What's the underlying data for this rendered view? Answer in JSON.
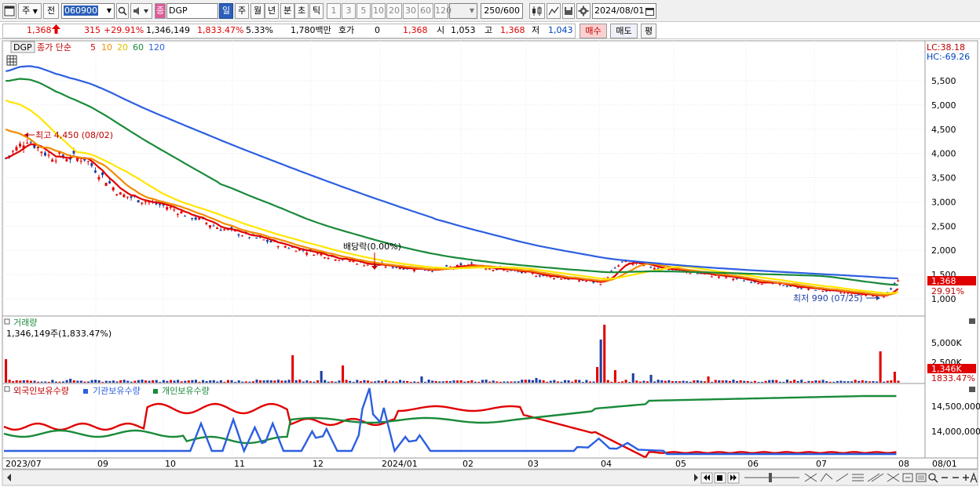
{
  "toolbar": {
    "market_tab": "주",
    "prev_label": "전",
    "stock_code": "060900",
    "stock_name": "DGP",
    "name_prefix": "종",
    "periods": [
      "일",
      "주",
      "월",
      "년",
      "분",
      "초",
      "틱"
    ],
    "selected_period": "일",
    "intervals": [
      "1",
      "3",
      "5",
      "10",
      "20",
      "30",
      "60",
      "120"
    ],
    "count_display": "250/600",
    "date": "2024/08/01"
  },
  "quote": {
    "price": "1,368",
    "change": "315",
    "change_pct": "+29.91%",
    "volume": "1,346,149",
    "volume_ratio": "1,833.47%",
    "turnover_rate": "5.33%",
    "amount": "1,780백만",
    "hoga_label": "호가",
    "hoga_value": "0",
    "hoga_price": "1,368",
    "open_label": "시",
    "open": "1,053",
    "high_label": "고",
    "high": "1,368",
    "low_label": "저",
    "low": "1,043",
    "buy_label": "매수",
    "sell_label": "매도",
    "eval_label": "평"
  },
  "price_panel": {
    "stock_tag": "DGP",
    "legend_title": "종가 단순",
    "ma_periods": [
      "5",
      "10",
      "20",
      "60",
      "120"
    ],
    "ma_colors": [
      "#e00000",
      "#f08c00",
      "#ffe600",
      "#1a8a3a",
      "#2c5fe0"
    ],
    "lc_label": "LC:38.18",
    "hc_label": "HC:-69.26",
    "high_annotation": "최고 4,450 (08/02)",
    "low_annotation": "최저 990 (07/25)",
    "dividend_annotation": "배당락(0.00%)",
    "y_ticks": [
      "5,500",
      "5,000",
      "4,500",
      "4,000",
      "3,500",
      "3,000",
      "2,500",
      "2,000",
      "1,500",
      "1,000"
    ],
    "price_label": "1,368",
    "pct_label": "29.91%"
  },
  "volume_panel": {
    "title": "거래량",
    "value_text": "1,346,149주(1,833.47%)",
    "y_ticks": [
      "5,000K",
      "2,500K"
    ],
    "last_label": "1,346K",
    "pct_label": "1833.47%"
  },
  "holding_panel": {
    "series": [
      "외국인보유수량",
      "기관보유수량",
      "개인보유수량"
    ],
    "series_colors": [
      "#e00000",
      "#2c5fe0",
      "#1a8a3a"
    ],
    "y_ticks": [
      "14,500,000",
      "14,000,000"
    ]
  },
  "x_axis": {
    "labels": [
      "2023/07",
      "09",
      "10",
      "11",
      "12",
      "2024/01",
      "02",
      "03",
      "04",
      "05",
      "06",
      "07",
      "08"
    ],
    "right_label": "08/01"
  }
}
